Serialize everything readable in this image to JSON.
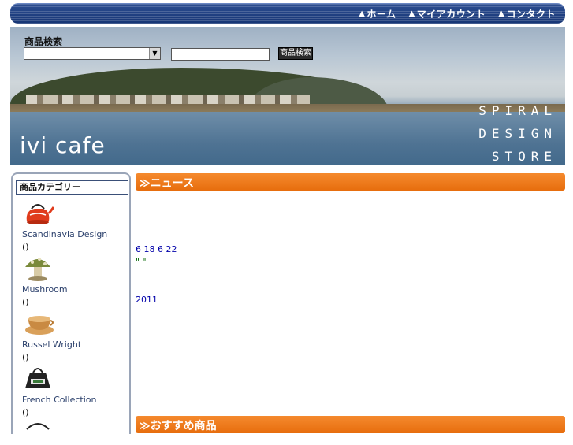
{
  "nav": {
    "items": [
      {
        "label": "ホーム",
        "icon": "triangle-icon"
      },
      {
        "label": "マイアカウント",
        "icon": "triangle-icon"
      },
      {
        "label": "コンタクト",
        "icon": "triangle-icon"
      }
    ]
  },
  "search": {
    "label": "商品検索",
    "select_value": "",
    "input_value": "",
    "button_label": "商品検索"
  },
  "banner": {
    "logo": "ivi cafe",
    "brand_lines": [
      "SPIRAL",
      "DESIGN",
      "STORE"
    ]
  },
  "sidebar": {
    "title": "商品カテゴリー",
    "categories": [
      {
        "name": "Scandinavia Design",
        "sub": "()"
      },
      {
        "name": "Mushroom",
        "sub": "()"
      },
      {
        "name": "Russel Wright",
        "sub": "()"
      },
      {
        "name": "French Collection",
        "sub": "()"
      }
    ]
  },
  "news": {
    "header": "≫ニュース",
    "date_line": "6 18 6 22",
    "quote_line": "\"                              \"",
    "year_line": "2011"
  },
  "recommend": {
    "header": "≫おすすめ商品"
  },
  "colors": {
    "nav_bg": "#1e3f80",
    "orange_header": "#f07a1e",
    "link_blue": "#0000cc"
  }
}
